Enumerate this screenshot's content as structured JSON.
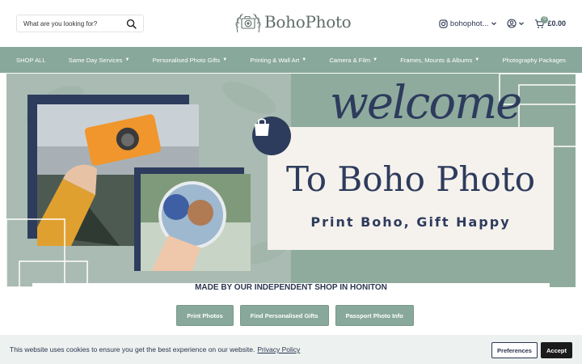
{
  "header": {
    "search_placeholder": "What are you looking for?",
    "logo_text": "BohoPhoto",
    "instagram_label": "bohophot...",
    "cart_count": "0",
    "cart_total": "£0.00"
  },
  "nav": {
    "items": [
      {
        "label": "SHOP ALL",
        "has_dropdown": false
      },
      {
        "label": "Same Day Services",
        "has_dropdown": true
      },
      {
        "label": "Personalised Photo Gifts",
        "has_dropdown": true
      },
      {
        "label": "Printing & Wall Art",
        "has_dropdown": true
      },
      {
        "label": "Camera & Film",
        "has_dropdown": true
      },
      {
        "label": "Frames, Mounts & Albums",
        "has_dropdown": true
      },
      {
        "label": "Photography Packages",
        "has_dropdown": false
      }
    ]
  },
  "hero": {
    "welcome": "welcome",
    "title": "To Boho Photo",
    "subtitle": "Print Boho, Gift Happy"
  },
  "main": {
    "made_by": "MADE BY OUR INDEPENDENT SHOP IN HONITON",
    "buttons": [
      "Print Photos",
      "Find Personalised Gifts",
      "Passport Photo Info"
    ]
  },
  "cookie": {
    "text": "This website uses cookies to ensure you get the best experience on our website.",
    "link": "Privacy Policy",
    "preferences": "Preferences",
    "accept": "Accept"
  },
  "colors": {
    "accent": "#88a89b",
    "navy": "#2d3b5d",
    "cream": "#f5f1ec"
  }
}
